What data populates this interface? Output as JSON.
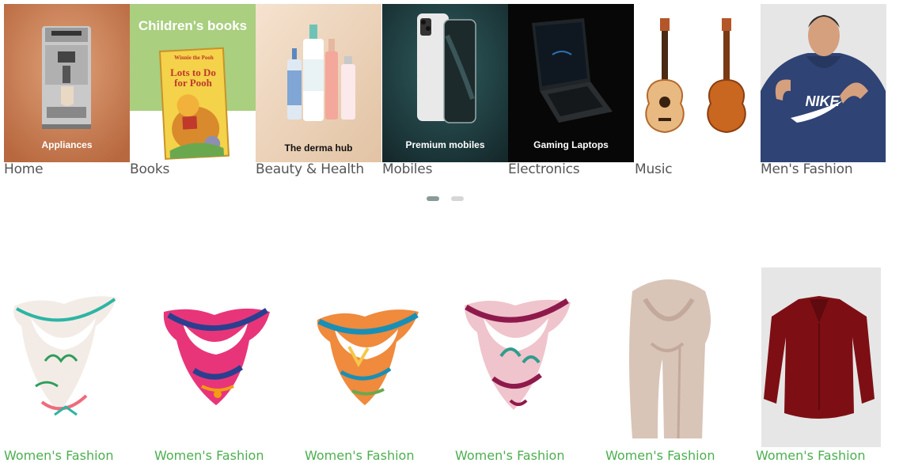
{
  "categories": [
    {
      "label": "Home",
      "caption": "Appliances"
    },
    {
      "label": "Books",
      "heading": "Children's books",
      "book_title": "Lots to Do for Pooh",
      "book_series": "Winnie the Pooh"
    },
    {
      "label": "Beauty & Health",
      "caption": "The derma hub"
    },
    {
      "label": "Mobiles",
      "caption": "Premium mobiles"
    },
    {
      "label": "Electronics",
      "caption": "Gaming Laptops"
    },
    {
      "label": "Music"
    },
    {
      "label": "Men's Fashion",
      "shirt_logo": "NIKE"
    }
  ],
  "carousel": {
    "active_page": 1,
    "total_pages": 2,
    "active_color": "#8a9a98",
    "inactive_color": "#d6d6d6"
  },
  "products": [
    {
      "category": "Women's Fashion",
      "image": "white-floral-silk-scarf"
    },
    {
      "category": "Women's Fashion",
      "image": "pink-blue-silk-scarf"
    },
    {
      "category": "Women's Fashion",
      "image": "orange-teal-silk-scarf"
    },
    {
      "category": "Women's Fashion",
      "image": "purple-floral-silk-scarf"
    },
    {
      "category": "Women's Fashion",
      "image": "beige-long-scarf"
    },
    {
      "category": "Women's Fashion",
      "image": "burgundy-blouse"
    }
  ],
  "colors": {
    "label_text": "#555555",
    "product_link": "#4caf50"
  }
}
